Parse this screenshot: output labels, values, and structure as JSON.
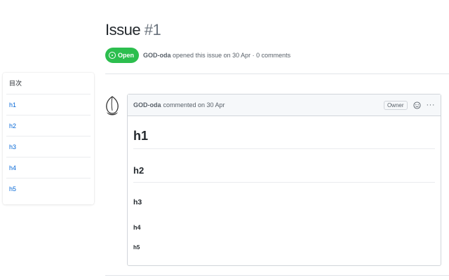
{
  "issue": {
    "title": "Issue",
    "number": "#1",
    "state": "Open",
    "author": "GOD-oda",
    "meta_text": "opened this issue on 30 Apr · 0 comments"
  },
  "toc": {
    "header": "目次",
    "items": [
      {
        "label": "h1"
      },
      {
        "label": "h2"
      },
      {
        "label": "h3"
      },
      {
        "label": "h4"
      },
      {
        "label": "h5"
      }
    ]
  },
  "comment": {
    "author": "GOD-oda",
    "meta_text": "commented on 30 Apr",
    "owner_label": "Owner",
    "more_label": "···",
    "body": {
      "h1": "h1",
      "h2": "h2",
      "h3": "h3",
      "h4": "h4",
      "h5": "h5"
    }
  },
  "colors": {
    "open_green": "#2cbe4e",
    "link_blue": "#0366d6"
  },
  "icons": {
    "state": "issue-open-icon",
    "reaction": "smiley-icon",
    "avatar": "peach-avatar"
  }
}
